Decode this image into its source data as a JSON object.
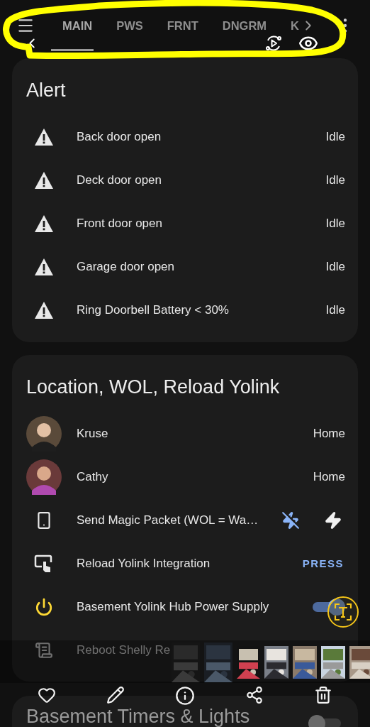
{
  "header": {
    "tabs": [
      {
        "label": "MAIN",
        "selected": true
      },
      {
        "label": "PWS",
        "selected": false
      },
      {
        "label": "FRNT",
        "selected": false
      },
      {
        "label": "DNGRM",
        "selected": false
      },
      {
        "label": "K",
        "selected": false
      }
    ]
  },
  "alert_card": {
    "title": "Alert",
    "rows": [
      {
        "label": "Back door open",
        "state": "Idle"
      },
      {
        "label": "Deck door open",
        "state": "Idle"
      },
      {
        "label": "Front door open",
        "state": "Idle"
      },
      {
        "label": "Garage door open",
        "state": "Idle"
      },
      {
        "label": "Ring Doorbell Battery < 30%",
        "state": "Idle"
      }
    ]
  },
  "location_card": {
    "title": "Location, WOL, Reload Yolink",
    "rows": [
      {
        "kind": "person",
        "label": "Kruse",
        "state": "Home"
      },
      {
        "kind": "person",
        "label": "Cathy",
        "state": "Home"
      },
      {
        "kind": "actions",
        "label": "Send Magic Packet (WOL = Wa…",
        "actions": [
          {
            "kind": "off",
            "selected": true
          },
          {
            "kind": "on",
            "selected": false
          }
        ]
      },
      {
        "kind": "press",
        "label": "Reload Yolink Integration",
        "action": "PRESS"
      },
      {
        "kind": "toggle",
        "label": "Basement Yolink Hub Power Supply",
        "on": true
      },
      {
        "kind": "script",
        "label": "Reboot Shelly Re"
      }
    ]
  },
  "timers_card": {
    "title": "Basement Timers & Lights",
    "on": false
  }
}
